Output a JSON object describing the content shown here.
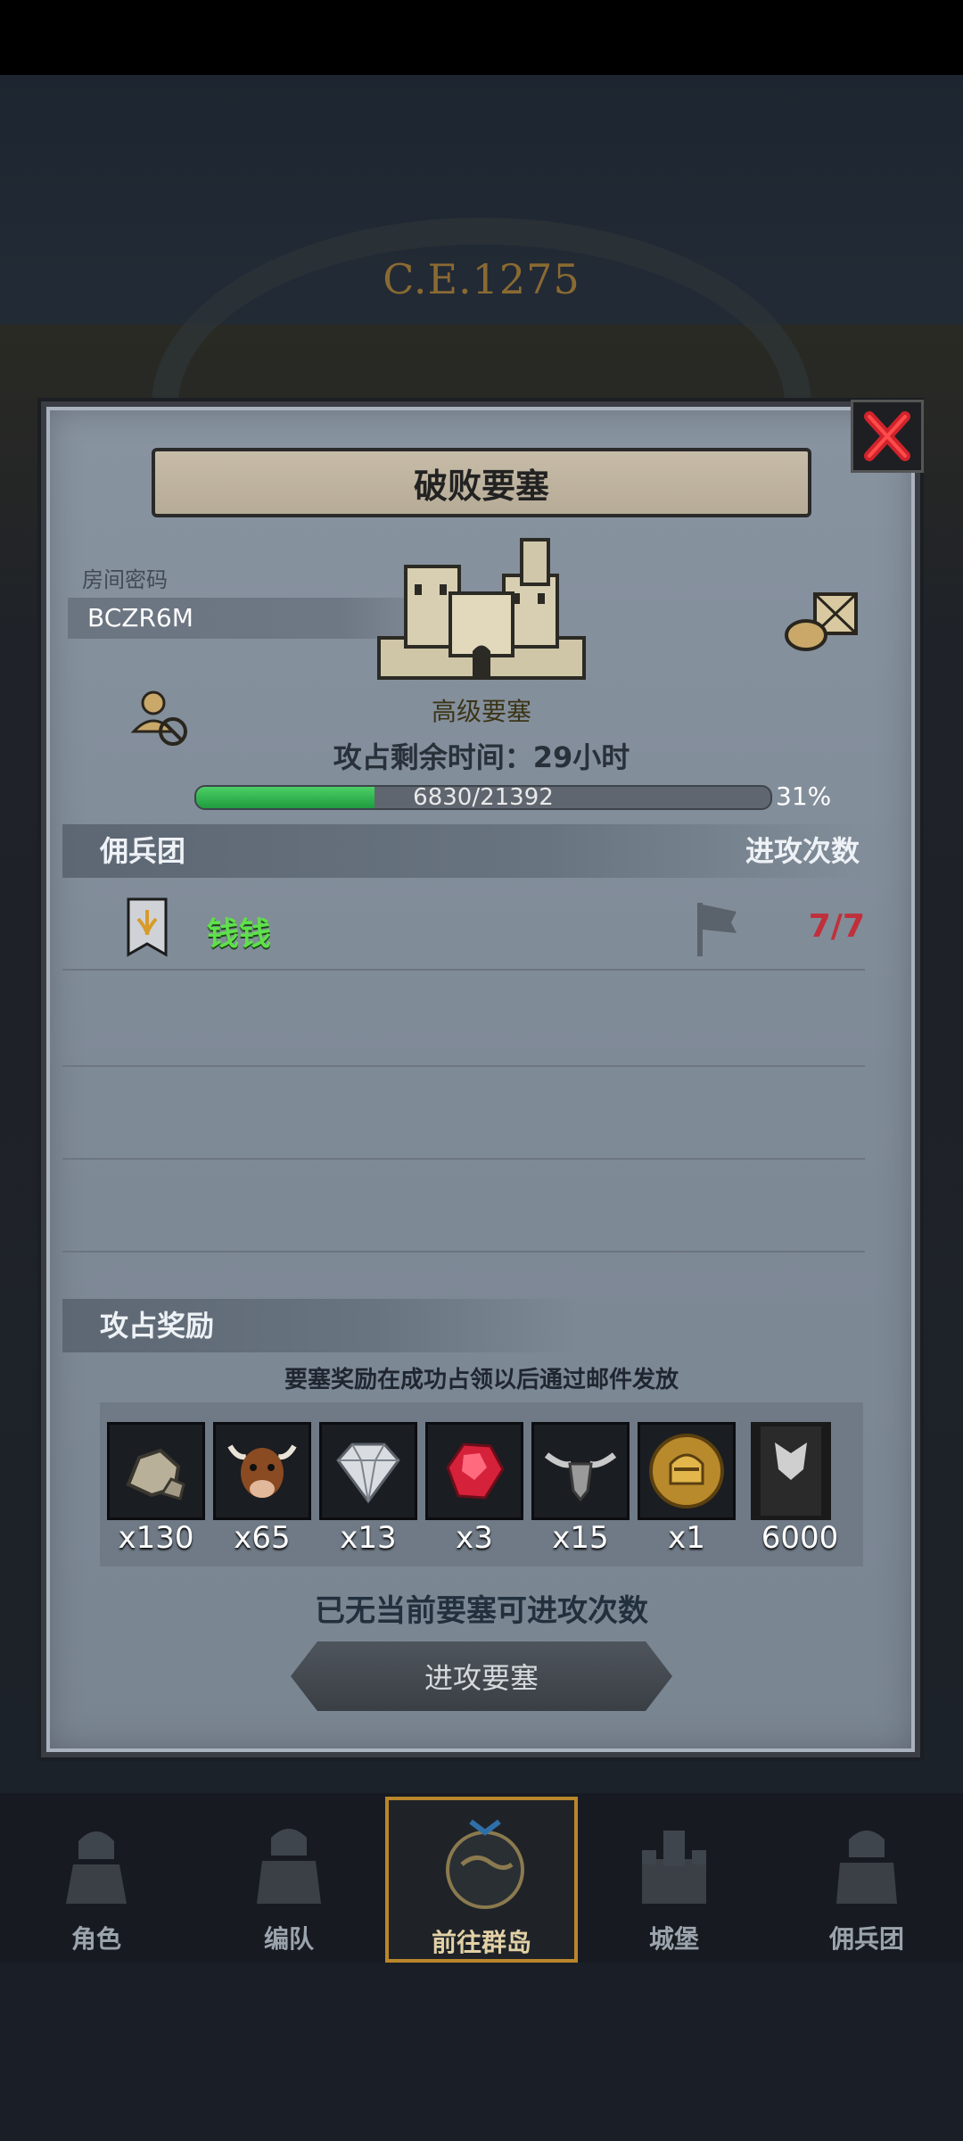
{
  "background": {
    "era": "C.E.1275"
  },
  "modal": {
    "title": "破败要塞",
    "room": {
      "label": "房间密码",
      "code": "BCZR6M"
    },
    "fortress_level": "高级要塞",
    "time_remaining": "攻占剩余时间：29小时",
    "progress": {
      "text": "6830/21392",
      "percent_text": "31%",
      "fraction": 0.31
    },
    "mercenary": {
      "header": "佣兵团",
      "attacks_header": "进攻次数",
      "rows": [
        {
          "name": "钱钱",
          "attacks": "7/7"
        }
      ]
    },
    "rewards": {
      "header": "攻占奖励",
      "note": "要塞奖励在成功占领以后通过邮件发放",
      "items": [
        {
          "icon": "stone-icon",
          "qty": "x130"
        },
        {
          "icon": "bull-icon",
          "qty": "x65"
        },
        {
          "icon": "diamond-icon",
          "qty": "x13"
        },
        {
          "icon": "ruby-icon",
          "qty": "x3"
        },
        {
          "icon": "demon-horn-icon",
          "qty": "x15"
        },
        {
          "icon": "helmet-coin-icon",
          "qty": "x1"
        },
        {
          "icon": "banner-icon",
          "qty": "6000"
        }
      ]
    },
    "no_attempts": "已无当前要塞可进攻次数",
    "attack_button": "进攻要塞"
  },
  "nav": [
    {
      "label": "角色",
      "icon": "knight-icon"
    },
    {
      "label": "编队",
      "icon": "squad-icon"
    },
    {
      "label": "前往群岛",
      "icon": "islands-icon",
      "active": true
    },
    {
      "label": "城堡",
      "icon": "castle-icon"
    },
    {
      "label": "佣兵团",
      "icon": "mercenary-icon"
    }
  ],
  "colors": {
    "progress_fill": "#2fbf4f",
    "merc_name": "#5fe04c",
    "attack_count": "#c0303b",
    "nav_active_border": "#b9862b"
  }
}
